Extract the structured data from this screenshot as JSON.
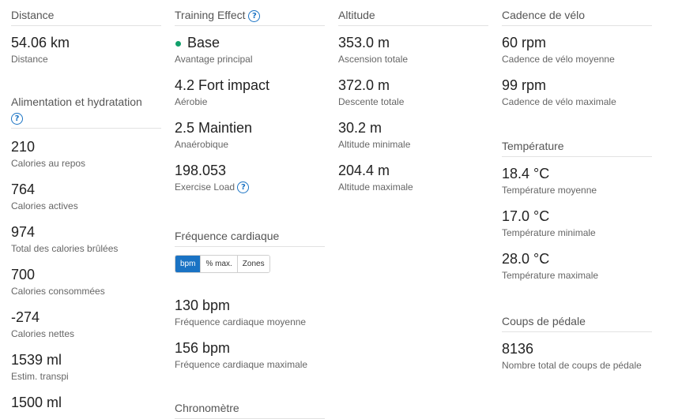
{
  "distance": {
    "title": "Distance",
    "stats": [
      {
        "value": "54.06 km",
        "label": "Distance"
      }
    ]
  },
  "nutrition": {
    "title": "Alimentation et hydratation",
    "stats": [
      {
        "value": "210",
        "label": "Calories au repos"
      },
      {
        "value": "764",
        "label": "Calories actives"
      },
      {
        "value": "974",
        "label": "Total des calories brûlées"
      },
      {
        "value": "700",
        "label": "Calories consommées"
      },
      {
        "value": "-274",
        "label": "Calories nettes"
      },
      {
        "value": "1539 ml",
        "label": "Estim. transpi"
      },
      {
        "value": "1500 ml",
        "label": ""
      }
    ]
  },
  "training": {
    "title": "Training Effect",
    "primary": {
      "value": "Base",
      "label": "Avantage principal",
      "dot_color": "#11a06b"
    },
    "aerobic": {
      "value": "4.2 Fort impact",
      "label": "Aérobie"
    },
    "anaerobic": {
      "value": "2.5 Maintien",
      "label": "Anaérobique"
    },
    "load": {
      "value": "198.053",
      "label": "Exercise Load"
    }
  },
  "heart": {
    "title": "Fréquence cardiaque",
    "toggle": [
      "bpm",
      "% max.",
      "Zones"
    ],
    "stats": [
      {
        "value": "130 bpm",
        "label": "Fréquence cardiaque moyenne"
      },
      {
        "value": "156 bpm",
        "label": "Fréquence cardiaque maximale"
      }
    ],
    "next_title": "Chronomètre"
  },
  "altitude": {
    "title": "Altitude",
    "stats": [
      {
        "value": "353.0 m",
        "label": "Ascension totale"
      },
      {
        "value": "372.0 m",
        "label": "Descente totale"
      },
      {
        "value": "30.2 m",
        "label": "Altitude minimale"
      },
      {
        "value": "204.4 m",
        "label": "Altitude maximale"
      }
    ]
  },
  "cadence": {
    "title": "Cadence de vélo",
    "stats": [
      {
        "value": "60 rpm",
        "label": "Cadence de vélo moyenne"
      },
      {
        "value": "99 rpm",
        "label": "Cadence de vélo maximale"
      }
    ]
  },
  "temperature": {
    "title": "Température",
    "stats": [
      {
        "value": "18.4 °C",
        "label": "Température moyenne"
      },
      {
        "value": "17.0 °C",
        "label": "Température minimale"
      },
      {
        "value": "28.0 °C",
        "label": "Température maximale"
      }
    ]
  },
  "strokes": {
    "title": "Coups de pédale",
    "stats": [
      {
        "value": "8136",
        "label": "Nombre total de coups de pédale"
      }
    ]
  },
  "help_icon": "?",
  "accent": "#1a73c4"
}
